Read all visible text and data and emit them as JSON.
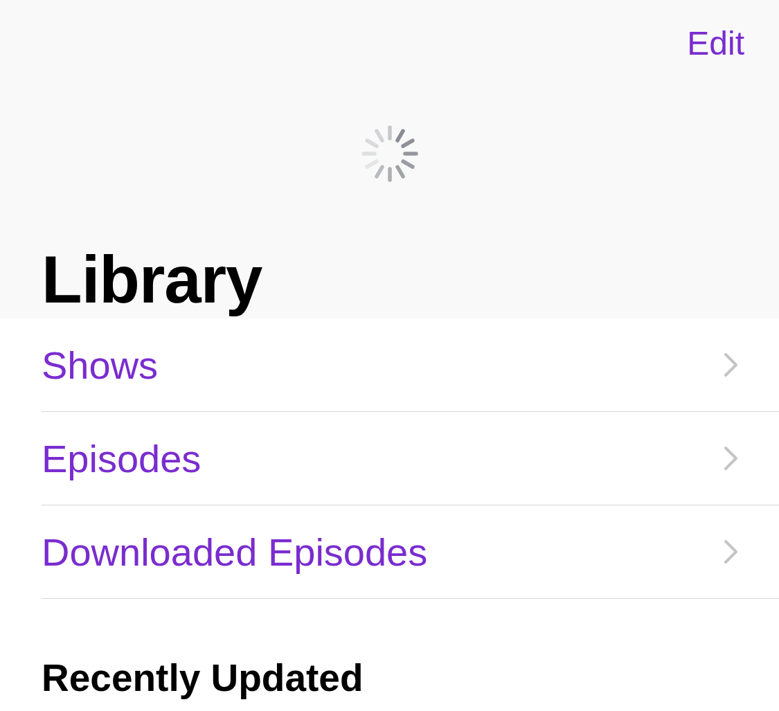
{
  "nav": {
    "action": "Edit"
  },
  "title": "Library",
  "rows": [
    {
      "label": "Shows"
    },
    {
      "label": "Episodes"
    },
    {
      "label": "Downloaded Episodes"
    }
  ],
  "section_title": "Recently Updated"
}
